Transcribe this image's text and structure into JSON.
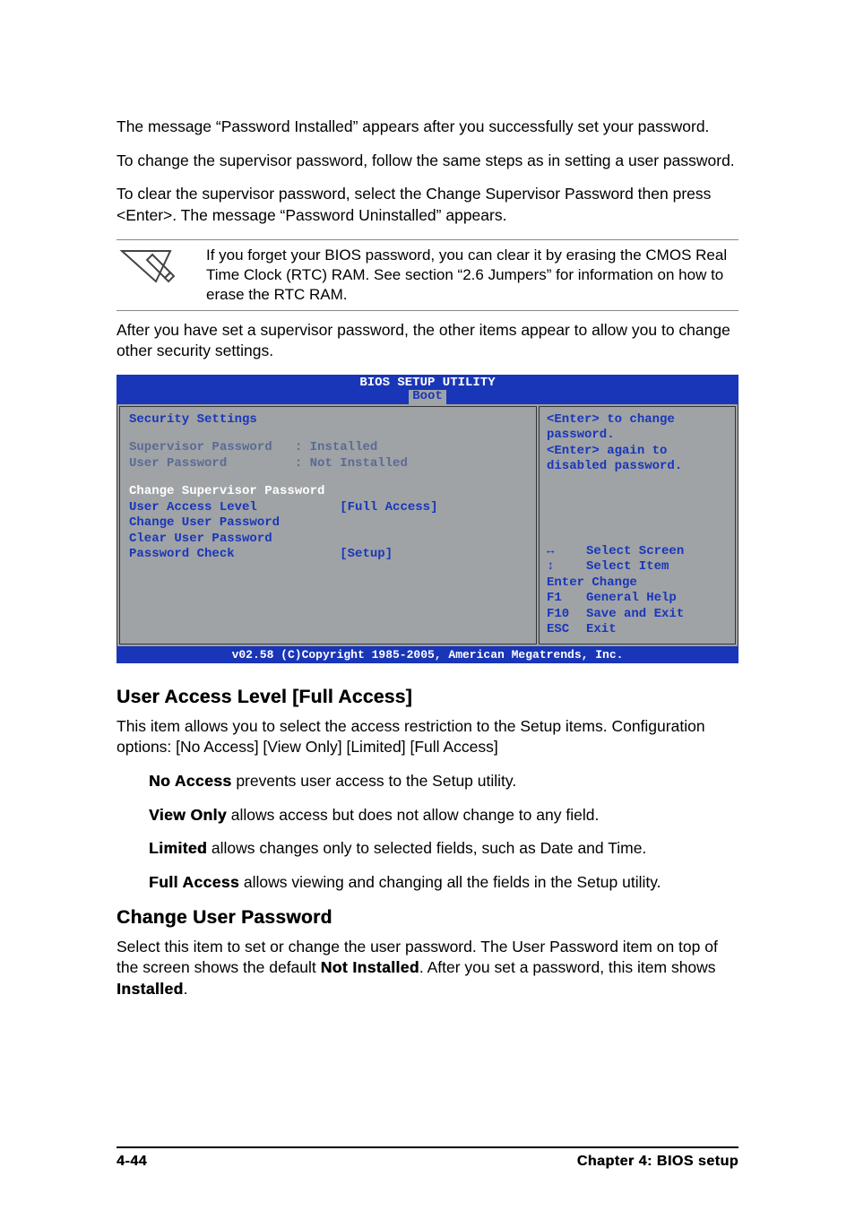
{
  "body": {
    "p1": "The message “Password Installed” appears after you successfully set your password.",
    "p2": "To change the supervisor password, follow the same steps as in setting a user password.",
    "p3": "To clear the supervisor password, select the Change Supervisor Password then press <Enter>. The message “Password Uninstalled” appears.",
    "note": "If you forget your BIOS password, you can clear it by erasing the CMOS Real Time Clock (RTC) RAM. See section “2.6  Jumpers” for information on how to erase the RTC RAM.",
    "p4": "After you have set a supervisor password, the other items appear to allow you to change other security settings."
  },
  "bios": {
    "title": "BIOS SETUP UTILITY",
    "tab": "Boot",
    "left_title": "Security Settings",
    "supervisor_label": "Supervisor Password",
    "supervisor_value": "Installed",
    "user_label": "User Password",
    "user_value": "Not Installed",
    "items": {
      "change_supervisor": "Change Supervisor Password",
      "user_access_level_label": "User Access Level",
      "user_access_level_value": "[Full Access]",
      "change_user": "Change User Password",
      "clear_user": "Clear User Password",
      "password_check_label": "Password Check",
      "password_check_value": "[Setup]"
    },
    "help_top_1": "<Enter> to change",
    "help_top_2": "password.",
    "help_top_3": "<Enter> again to",
    "help_top_4": "disabled password.",
    "keys": {
      "lr": "Select Screen",
      "ud": "Select Item",
      "enter": "Enter Change",
      "f1": "General Help",
      "f10": "Save and Exit",
      "esc": "Exit"
    },
    "footer": "v02.58 (C)Copyright 1985-2005, American Megatrends, Inc."
  },
  "sec1": {
    "heading": "User Access Level [Full Access]",
    "p": "This item allows you to select the access restriction to the Setup items. Configuration options: [No Access] [View Only] [Limited] [Full Access]",
    "opts": {
      "no_access_b": "No Access",
      "no_access_t": " prevents user access to the Setup utility.",
      "view_only_b": "View Only",
      "view_only_t": " allows access but does not allow change to any field.",
      "limited_b": "Limited",
      "limited_t": " allows changes only to selected fields, such as Date and Time.",
      "full_access_b": "Full Access",
      "full_access_t": " allows viewing and changing all the fields in the Setup utility."
    }
  },
  "sec2": {
    "heading": "Change User Password",
    "p_a": "Select this item to set or change the user password. The User Password item on top of the screen shows the default ",
    "p_b": "Not Installed",
    "p_c": ". After you set a password, this item shows ",
    "p_d": "Installed",
    "p_e": "."
  },
  "footer": {
    "page": "4-44",
    "chapter": "Chapter 4: BIOS setup"
  }
}
